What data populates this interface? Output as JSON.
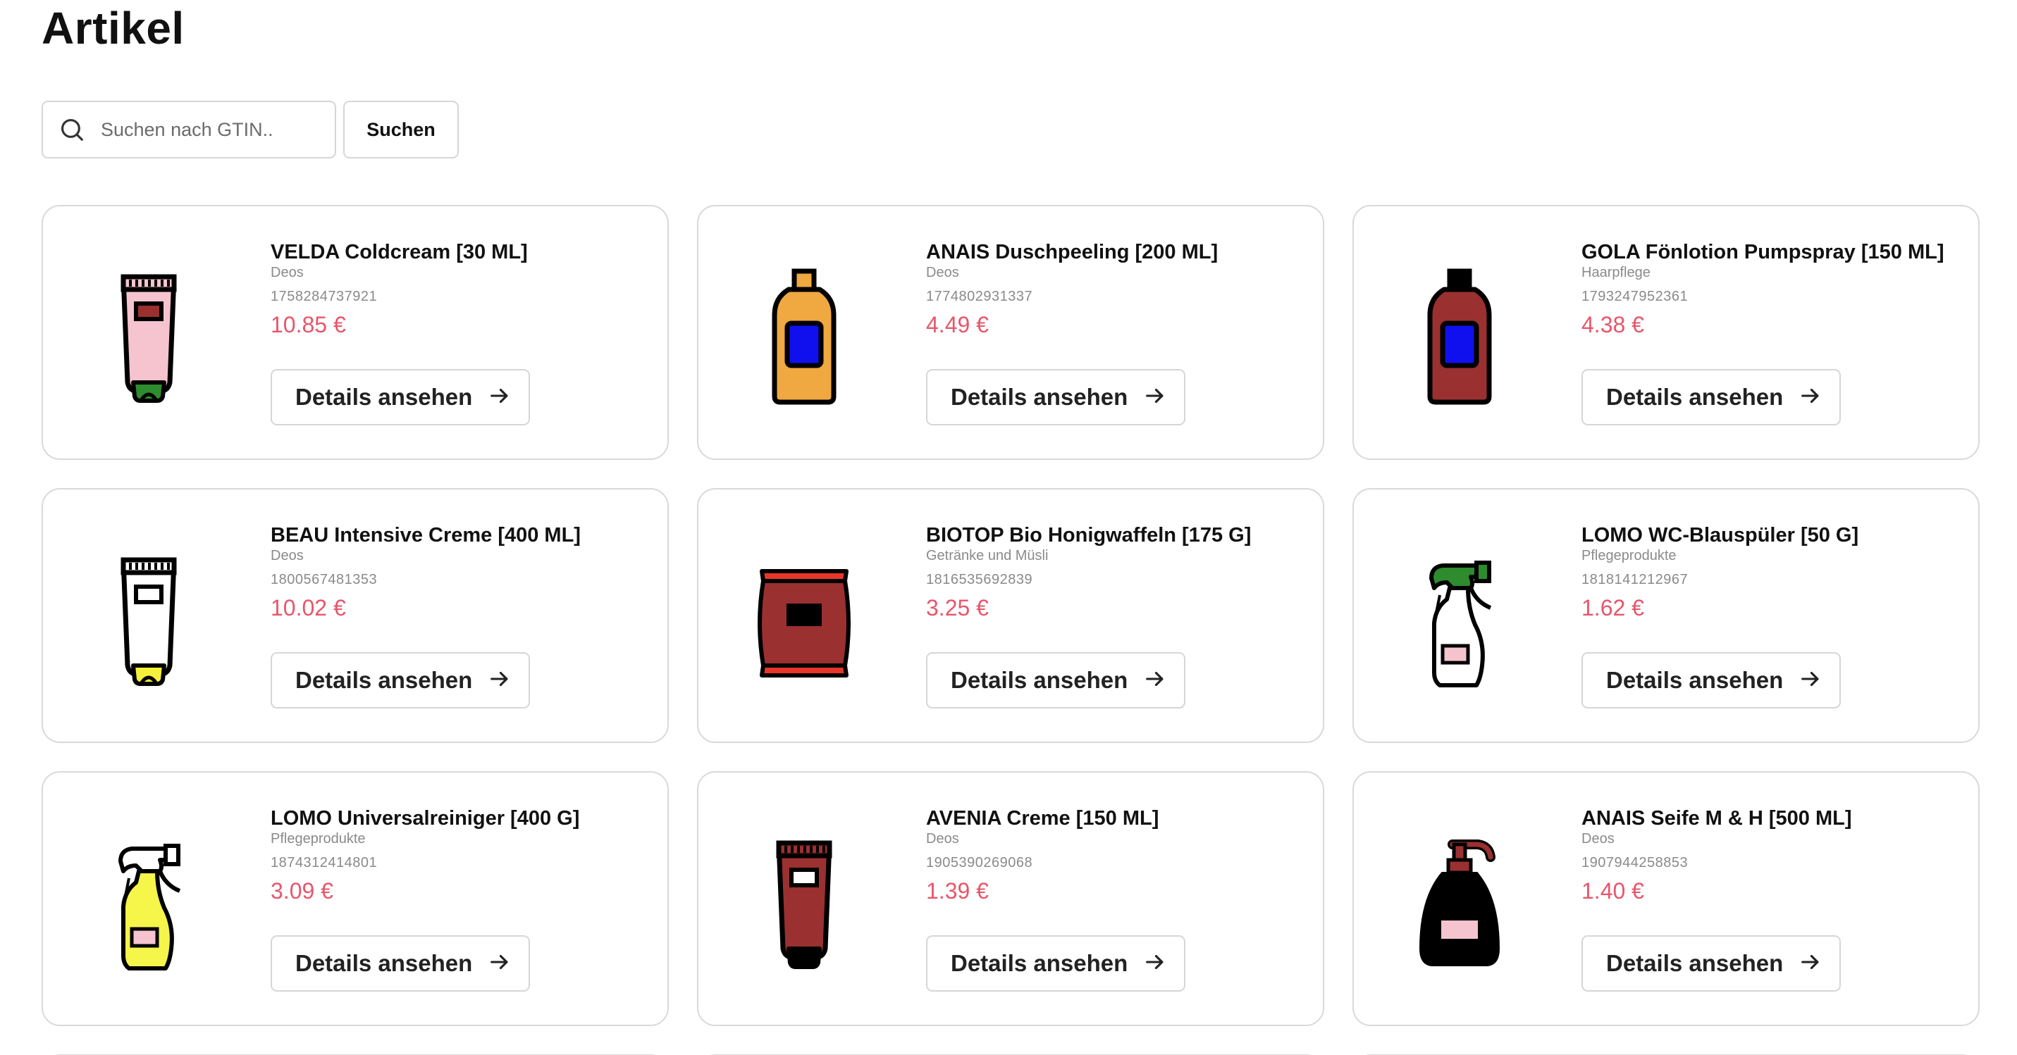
{
  "page": {
    "title": "Artikel"
  },
  "search": {
    "placeholder": "Suchen nach GTIN..",
    "value": "",
    "button_label": "Suchen",
    "icon": "search-icon"
  },
  "products": [
    {
      "name": "VELDA Coldcream [30 ML]",
      "category": "Deos",
      "gtin": "1758284737921",
      "price": "10.85 €",
      "button_label": "Details ansehen",
      "image": "tube-icon",
      "colors": {
        "body": "#f5c4cf",
        "cap": "#2e8b2e",
        "label": "#9b3030"
      }
    },
    {
      "name": "ANAIS Duschpeeling [200 ML]",
      "category": "Deos",
      "gtin": "1774802931337",
      "price": "4.49 €",
      "button_label": "Details ansehen",
      "image": "bottle-icon",
      "colors": {
        "body": "#f0a840",
        "cap": "#f0a840",
        "label": "#1010ee"
      }
    },
    {
      "name": "GOLA Fönlotion Pumpspray [150 ML]",
      "category": "Haarpflege",
      "gtin": "1793247952361",
      "price": "4.38 €",
      "button_label": "Details ansehen",
      "image": "bottle-icon",
      "colors": {
        "body": "#9b3030",
        "cap": "#000000",
        "label": "#1010ee"
      }
    },
    {
      "name": "BEAU Intensive Creme [400 ML]",
      "category": "Deos",
      "gtin": "1800567481353",
      "price": "10.02 €",
      "button_label": "Details ansehen",
      "image": "tube-icon",
      "colors": {
        "body": "#ffffff",
        "cap": "#f5f03a",
        "label": "#ffffff"
      }
    },
    {
      "name": "BIOTOP Bio Honigwaffeln [175 G]",
      "category": "Getränke und Müsli",
      "gtin": "1816535692839",
      "price": "3.25 €",
      "button_label": "Details ansehen",
      "image": "package-bag-icon",
      "colors": {
        "body": "#9b3030",
        "cap": "#e8362a",
        "label": "#000000"
      }
    },
    {
      "name": "LOMO WC-Blauspüler [50 G]",
      "category": "Pflegeprodukte",
      "gtin": "1818141212967",
      "price": "1.62 €",
      "button_label": "Details ansehen",
      "image": "spray-bottle-icon",
      "colors": {
        "body": "#ffffff",
        "cap": "#2e8b2e",
        "label": "#f5c4cf"
      }
    },
    {
      "name": "LOMO Universalreiniger [400 G]",
      "category": "Pflegeprodukte",
      "gtin": "1874312414801",
      "price": "3.09 €",
      "button_label": "Details ansehen",
      "image": "spray-bottle-icon",
      "colors": {
        "body": "#f5f54a",
        "cap": "#ffffff",
        "label": "#f5c4cf"
      }
    },
    {
      "name": "AVENIA Creme [150 ML]",
      "category": "Deos",
      "gtin": "1905390269068",
      "price": "1.39 €",
      "button_label": "Details ansehen",
      "image": "tube-icon",
      "colors": {
        "body": "#9b3030",
        "cap": "#000000",
        "label": "#ffffff"
      }
    },
    {
      "name": "ANAIS Seife M & H [500 ML]",
      "category": "Deos",
      "gtin": "1907944258853",
      "price": "1.40 €",
      "button_label": "Details ansehen",
      "image": "pump-dispenser-icon",
      "colors": {
        "body": "#000000",
        "cap": "#9b3030",
        "label": "#f5c4cf"
      }
    }
  ],
  "theme": {
    "price_color": "#e8566a",
    "border_color": "#d9d9d9",
    "muted_text": "#8a8a8a"
  }
}
